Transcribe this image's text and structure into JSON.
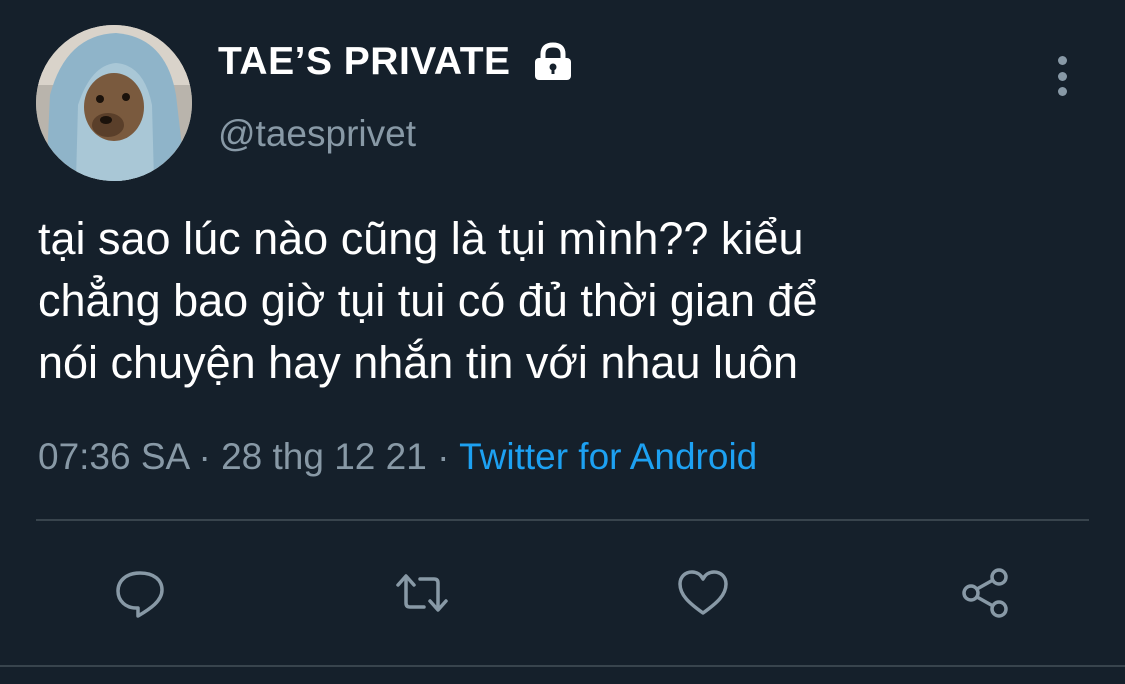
{
  "user": {
    "display_name": "TAE’S PRIVATE",
    "handle": "@taesprivet",
    "protected_icon": "lock-icon"
  },
  "tweet": {
    "lines": [
      "tại sao lúc nào cũng là tụi mình?? kiểu",
      "chẳng bao giờ tụi tui có đủ thời gian để",
      "nói chuyện hay nhắn tin với nhau luôn"
    ]
  },
  "meta": {
    "time": "07:36 SA",
    "separator": "·",
    "date": "28 thg 12 21",
    "source": "Twitter for Android"
  },
  "actions": {
    "reply_icon": "reply-icon",
    "retweet_icon": "retweet-icon",
    "like_icon": "heart-icon",
    "share_icon": "share-icon",
    "more_icon": "more-vertical-icon"
  },
  "colors": {
    "background": "#15202b",
    "text": "#ffffff",
    "secondary": "#8899a6",
    "link": "#1da1f2",
    "divider": "#38444d"
  }
}
